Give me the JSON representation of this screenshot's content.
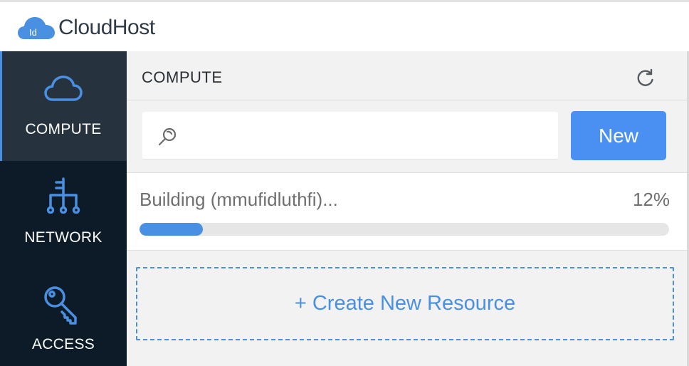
{
  "app": {
    "logo_badge": "Id",
    "name": "CloudHost"
  },
  "sidebar": {
    "items": [
      {
        "label": "COMPUTE",
        "icon": "cloud-icon",
        "active": true
      },
      {
        "label": "NETWORK",
        "icon": "network-tree-icon",
        "active": false
      },
      {
        "label": "ACCESS",
        "icon": "key-icon",
        "active": false
      }
    ]
  },
  "main": {
    "section_title": "COMPUTE",
    "refresh_icon": "refresh-icon",
    "search": {
      "value": "",
      "placeholder": "",
      "icon": "search-icon"
    },
    "new_button_label": "New",
    "progress": {
      "label": "Building (mmufidluthfi)...",
      "percent_text": "12%",
      "fraction": 0.12
    },
    "create_label": "+ Create New Resource"
  },
  "colors": {
    "accent": "#4a90e2",
    "sidebar_bg": "#0c1b27",
    "sidebar_active_bg": "#26323d",
    "main_bg": "#f2f2f2"
  }
}
